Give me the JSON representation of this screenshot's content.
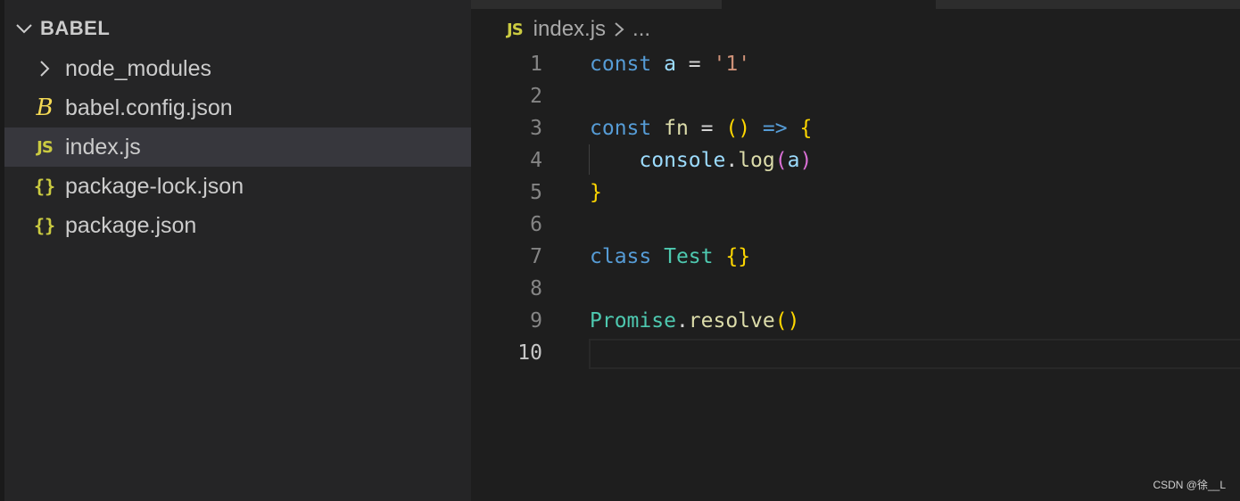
{
  "sidebar": {
    "folder": "BABEL",
    "items": [
      {
        "label": "node_modules",
        "icon": "chevron-right-icon",
        "type": "folder"
      },
      {
        "label": "babel.config.json",
        "icon": "babel-icon",
        "type": "file"
      },
      {
        "label": "index.js",
        "icon": "js-icon",
        "type": "file",
        "selected": true
      },
      {
        "label": "package-lock.json",
        "icon": "json-icon",
        "type": "file"
      },
      {
        "label": "package.json",
        "icon": "json-icon",
        "type": "file"
      }
    ]
  },
  "icons": {
    "js": "JS",
    "json": "{}",
    "babel": "B"
  },
  "editor": {
    "breadcrumb": {
      "file": "index.js",
      "more": "..."
    },
    "line_numbers": [
      "1",
      "2",
      "3",
      "4",
      "5",
      "6",
      "7",
      "8",
      "9",
      "10"
    ],
    "lines": [
      [
        [
          "kw",
          "const "
        ],
        [
          "var",
          "a"
        ],
        [
          "pl",
          " = "
        ],
        [
          "str",
          "'1'"
        ]
      ],
      [],
      [
        [
          "kw",
          "const "
        ],
        [
          "fn",
          "fn"
        ],
        [
          "pl",
          " = "
        ],
        [
          "br1",
          "()"
        ],
        [
          "kw",
          " =>"
        ],
        [
          "pl",
          " "
        ],
        [
          "br1",
          "{"
        ]
      ],
      [
        [
          "pl",
          "    "
        ],
        [
          "var",
          "console"
        ],
        [
          "pl",
          "."
        ],
        [
          "fn",
          "log"
        ],
        [
          "br2",
          "("
        ],
        [
          "var",
          "a"
        ],
        [
          "br2",
          ")"
        ]
      ],
      [
        [
          "br1",
          "}"
        ]
      ],
      [],
      [
        [
          "kw",
          "class "
        ],
        [
          "cls",
          "Test"
        ],
        [
          "pl",
          " "
        ],
        [
          "br1",
          "{}"
        ]
      ],
      [],
      [
        [
          "cls",
          "Promise"
        ],
        [
          "pl",
          "."
        ],
        [
          "fn",
          "resolve"
        ],
        [
          "br1",
          "()"
        ]
      ],
      []
    ]
  },
  "watermark": "CSDN @徐__L",
  "colors": {
    "keyword": "#569cd6",
    "variable": "#9cdcfe",
    "string": "#ce9178",
    "function": "#dcdcaa",
    "class": "#4ec9b0",
    "bracket1": "#ffd700",
    "bracket2": "#da70d6",
    "js_icon": "#cbcb41"
  }
}
